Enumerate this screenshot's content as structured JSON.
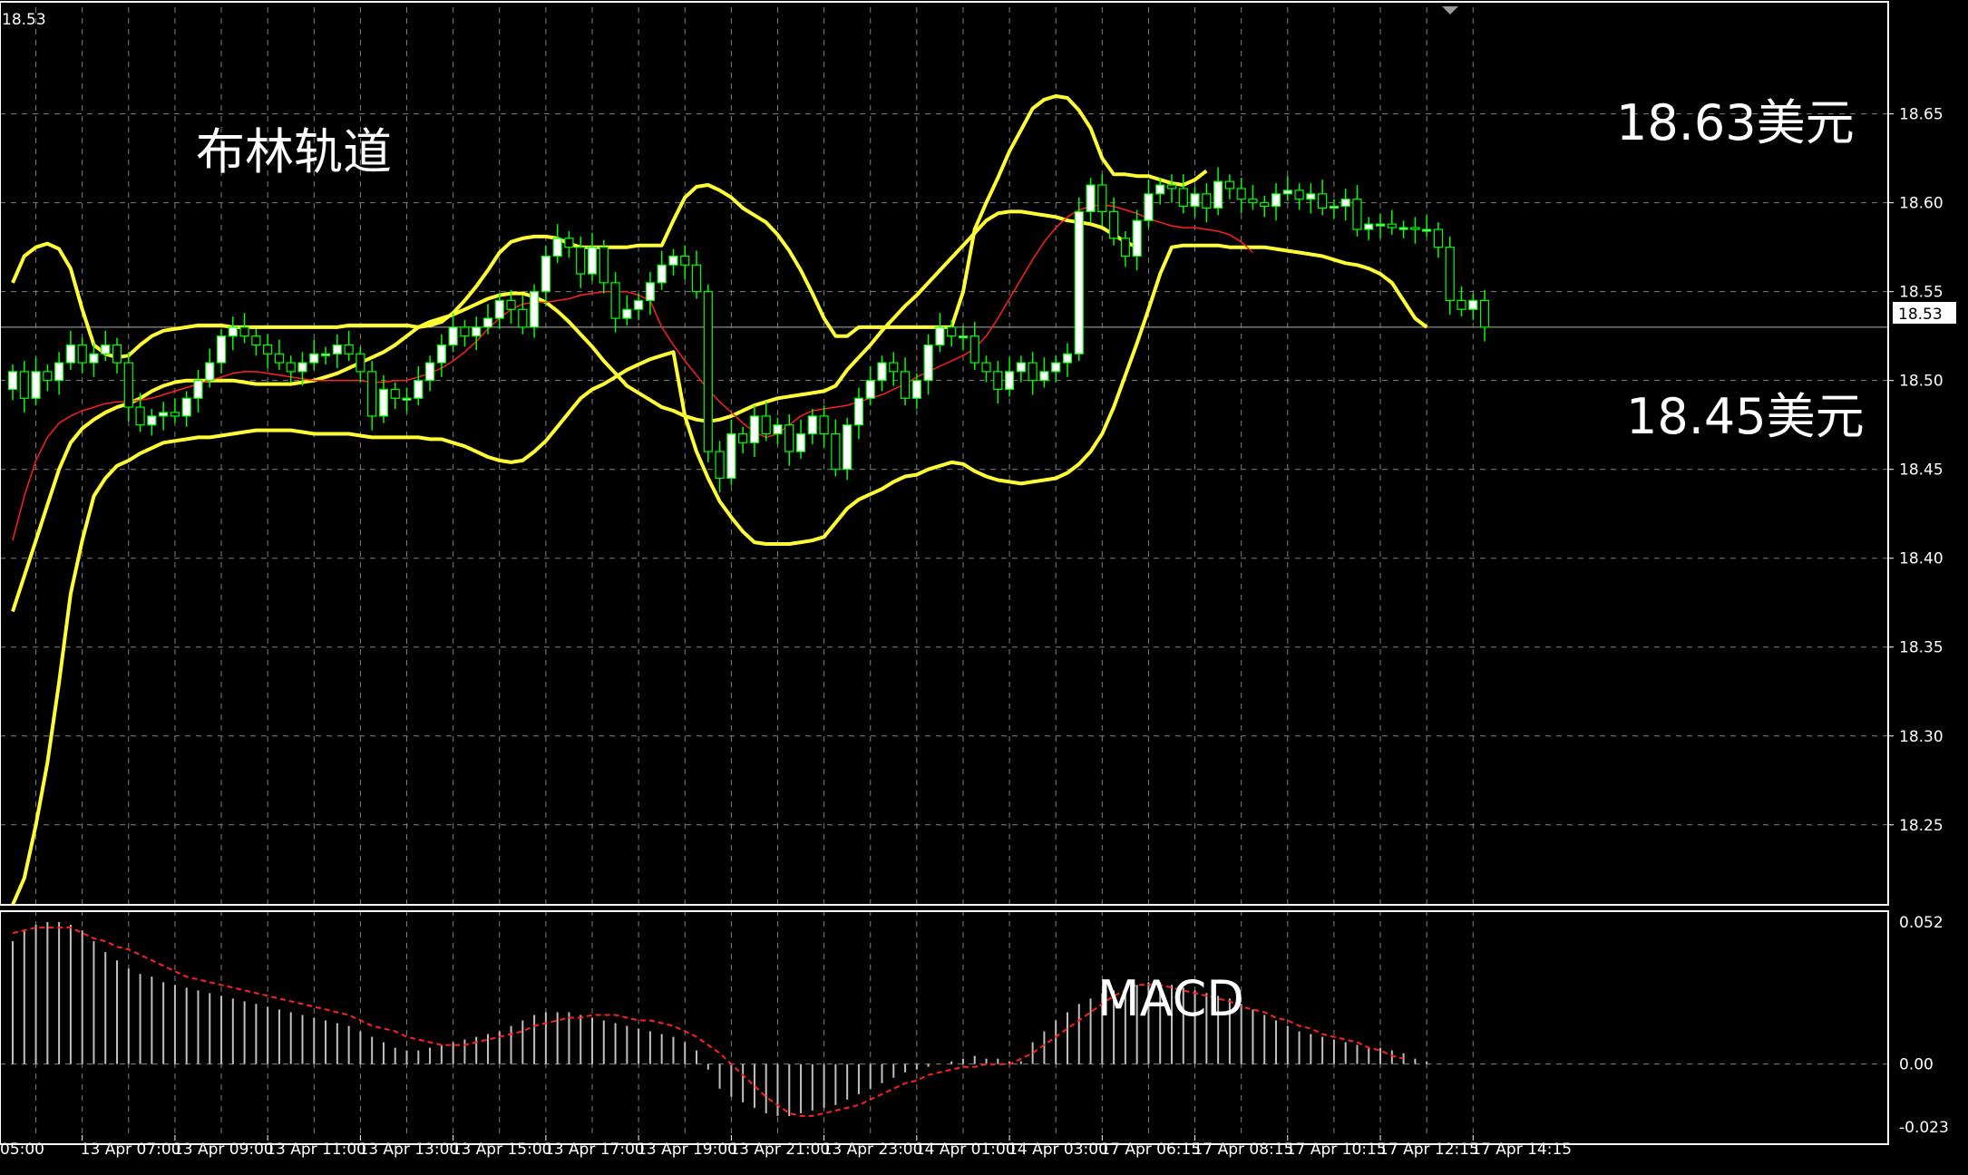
{
  "chart_data": {
    "type": "candlestick",
    "top_left_price": "18.53",
    "price_axis": {
      "ticks": [
        "18.65",
        "18.60",
        "18.55",
        "18.50",
        "18.45",
        "18.40",
        "18.35",
        "18.30",
        "18.25"
      ],
      "tick_values": [
        18.65,
        18.6,
        18.55,
        18.5,
        18.45,
        18.4,
        18.35,
        18.3,
        18.25
      ],
      "range": [
        18.205,
        18.71
      ],
      "current_price_label": "18.53",
      "current_price": 18.53
    },
    "macd_axis": {
      "ticks": [
        "0.052",
        "0.00",
        "-0.023"
      ],
      "tick_values": [
        0.052,
        0.0,
        -0.023
      ],
      "range": [
        -0.026,
        0.056
      ]
    },
    "time_axis": {
      "labels": [
        "05:00",
        "13 Apr 07:00",
        "13 Apr 09:00",
        "13 Apr 11:00",
        "13 Apr 13:00",
        "13 Apr 15:00",
        "13 Apr 17:00",
        "13 Apr 19:00",
        "13 Apr 21:00",
        "13 Apr 23:00",
        "14 Apr 01:00",
        "14 Apr 03:00",
        "17 Apr 06:15",
        "17 Apr 08:15",
        "17 Apr 10:15",
        "17 Apr 12:15",
        "17 Apr 14:15"
      ],
      "label_bar_index": [
        -2,
        6,
        14,
        22,
        30,
        38,
        46,
        54,
        62,
        70,
        78,
        86,
        94,
        102,
        110,
        118,
        126
      ]
    },
    "annotations": {
      "title": "布林轨道",
      "upper_price": "18.63美元",
      "lower_price": "18.45美元",
      "macd_label": "MACD"
    },
    "close": [
      18.505,
      18.49,
      18.505,
      18.5,
      18.51,
      18.52,
      18.51,
      18.515,
      18.52,
      18.51,
      18.485,
      18.475,
      18.48,
      18.482,
      18.48,
      18.49,
      18.5,
      18.51,
      18.525,
      18.53,
      18.525,
      18.52,
      18.515,
      18.51,
      18.505,
      18.51,
      18.515,
      18.515,
      18.52,
      18.515,
      18.505,
      18.48,
      18.495,
      18.49,
      18.49,
      18.5,
      18.51,
      18.52,
      18.53,
      18.525,
      18.53,
      18.535,
      18.545,
      18.54,
      18.53,
      18.55,
      18.57,
      18.58,
      18.575,
      18.56,
      18.575,
      18.555,
      18.535,
      18.54,
      18.545,
      18.555,
      18.565,
      18.57,
      18.565,
      18.55,
      18.46,
      18.445,
      18.47,
      18.465,
      18.48,
      18.47,
      18.475,
      18.46,
      18.47,
      18.48,
      18.47,
      18.45,
      18.475,
      18.49,
      18.5,
      18.51,
      18.505,
      18.49,
      18.5,
      18.52,
      18.53,
      18.525,
      18.525,
      18.51,
      18.505,
      18.495,
      18.505,
      18.51,
      18.5,
      18.505,
      18.51,
      18.515,
      18.595,
      18.61,
      18.595,
      18.58,
      18.57,
      18.59,
      18.605,
      18.61,
      18.608,
      18.598,
      18.605,
      18.597,
      18.612,
      18.608,
      18.602,
      18.6,
      18.598,
      18.605,
      18.607,
      18.602,
      18.605,
      18.597,
      18.598,
      18.602,
      18.585,
      18.588,
      18.588,
      18.586,
      18.586,
      18.585,
      18.585,
      18.575,
      18.545,
      18.54,
      18.545,
      18.53
    ],
    "bb_upper": [
      18.555,
      18.57,
      18.575,
      18.577,
      18.574,
      18.563,
      18.54,
      18.52,
      18.515,
      18.513,
      18.514,
      18.52,
      18.525,
      18.528,
      18.529,
      18.53,
      18.531,
      18.531,
      18.531,
      18.53,
      18.53,
      18.53,
      18.53,
      18.53,
      18.53,
      18.53,
      18.53,
      18.53,
      18.53,
      18.531,
      18.531,
      18.531,
      18.531,
      18.531,
      18.531,
      18.53,
      18.531,
      18.533,
      18.538,
      18.545,
      18.553,
      18.562,
      18.572,
      18.578,
      18.58,
      18.581,
      18.581,
      18.58,
      18.577,
      18.575,
      18.575,
      18.575,
      18.575,
      18.575,
      18.576,
      18.576,
      18.576,
      18.59,
      18.603,
      18.609,
      18.61,
      18.607,
      18.603,
      18.597,
      18.593,
      18.589,
      18.582,
      18.573,
      18.562,
      18.549,
      18.535,
      18.525,
      18.525,
      18.53,
      18.53,
      18.53,
      18.53,
      18.53,
      18.53,
      18.53,
      18.53,
      18.53,
      18.55,
      18.585,
      18.6,
      18.614,
      18.629,
      18.641,
      18.653,
      18.658,
      18.66,
      18.659,
      18.652,
      18.642,
      18.625,
      18.616,
      18.616,
      18.615,
      18.615,
      18.613,
      18.611,
      18.61,
      18.613,
      18.618
    ],
    "bb_middle": [
      18.37,
      18.39,
      18.41,
      18.43,
      18.45,
      18.465,
      18.473,
      18.478,
      18.482,
      18.485,
      18.487,
      18.49,
      18.494,
      18.497,
      18.499,
      18.5,
      18.5,
      18.5,
      18.5,
      18.5,
      18.499,
      18.498,
      18.498,
      18.498,
      18.498,
      18.499,
      18.5,
      18.502,
      18.504,
      18.507,
      18.51,
      18.513,
      18.516,
      18.52,
      18.525,
      18.53,
      18.533,
      18.535,
      18.537,
      18.54,
      18.543,
      18.546,
      18.548,
      18.549,
      18.549,
      18.547,
      18.544,
      18.539,
      18.533,
      18.526,
      18.519,
      18.511,
      18.504,
      18.497,
      18.493,
      18.489,
      18.485,
      18.483,
      18.48,
      18.478,
      18.477,
      18.478,
      18.48,
      18.483,
      18.486,
      18.488,
      18.49,
      18.491,
      18.492,
      18.493,
      18.494,
      18.497,
      18.506,
      18.513,
      18.52,
      18.528,
      18.535,
      18.542,
      18.548,
      18.555,
      18.562,
      18.569,
      18.576,
      18.583,
      18.59,
      18.594,
      18.595,
      18.595,
      18.594,
      18.593,
      18.592,
      18.59,
      18.589,
      18.588,
      18.586,
      18.582,
      18.578,
      18.575
    ],
    "bb_lower": [
      18.205,
      18.22,
      18.25,
      18.285,
      18.33,
      18.38,
      18.41,
      18.435,
      18.445,
      18.452,
      18.455,
      18.459,
      18.462,
      18.465,
      18.466,
      18.467,
      18.468,
      18.468,
      18.469,
      18.47,
      18.471,
      18.472,
      18.472,
      18.472,
      18.472,
      18.471,
      18.47,
      18.47,
      18.47,
      18.47,
      18.469,
      18.468,
      18.468,
      18.468,
      18.468,
      18.468,
      18.467,
      18.467,
      18.465,
      18.463,
      18.46,
      18.457,
      18.455,
      18.454,
      18.455,
      18.46,
      18.466,
      18.474,
      18.482,
      18.49,
      18.495,
      18.498,
      18.502,
      18.506,
      18.509,
      18.512,
      18.514,
      18.516,
      18.48,
      18.46,
      18.445,
      18.432,
      18.423,
      18.415,
      18.409,
      18.408,
      18.408,
      18.408,
      18.409,
      18.41,
      18.412,
      18.42,
      18.428,
      18.433,
      18.436,
      18.439,
      18.443,
      18.446,
      18.447,
      18.45,
      18.452,
      18.454,
      18.453,
      18.449,
      18.446,
      18.444,
      18.443,
      18.442,
      18.443,
      18.444,
      18.445,
      18.448,
      18.453,
      18.46,
      18.47,
      18.485,
      18.503,
      18.521,
      18.54,
      18.56,
      18.575,
      18.576,
      18.576,
      18.576,
      18.576,
      18.575,
      18.575,
      18.575,
      18.575,
      18.574,
      18.573,
      18.572,
      18.571,
      18.57,
      18.568,
      18.566,
      18.565,
      18.563,
      18.56,
      18.555,
      18.545,
      18.535,
      18.53
    ],
    "ma_red": [
      18.41,
      18.435,
      18.455,
      18.468,
      18.476,
      18.48,
      18.483,
      18.485,
      18.487,
      18.488,
      18.488,
      18.489,
      18.49,
      18.492,
      18.494,
      18.496,
      18.498,
      18.5,
      18.502,
      18.504,
      18.505,
      18.505,
      18.504,
      18.503,
      18.502,
      18.501,
      18.5,
      18.5,
      18.5,
      18.5,
      18.5,
      18.499,
      18.499,
      18.5,
      18.5,
      18.502,
      18.504,
      18.507,
      18.511,
      18.516,
      18.522,
      18.529,
      18.535,
      18.54,
      18.543,
      18.544,
      18.544,
      18.545,
      18.546,
      18.548,
      18.549,
      18.55,
      18.55,
      18.55,
      18.548,
      18.545,
      18.53,
      18.52,
      18.511,
      18.503,
      18.495,
      18.488,
      18.482,
      18.476,
      18.471,
      18.468,
      18.47,
      18.475,
      18.48,
      18.483,
      18.484,
      18.485,
      18.486,
      18.488,
      18.49,
      18.492,
      18.495,
      18.498,
      18.502,
      18.505,
      18.508,
      18.511,
      18.514,
      18.518,
      18.525,
      18.535,
      18.546,
      18.557,
      18.568,
      18.578,
      18.586,
      18.592,
      18.596,
      18.598,
      18.599,
      18.598,
      18.596,
      18.594,
      18.591,
      18.589,
      18.587,
      18.586,
      18.586,
      18.585,
      18.584,
      18.582,
      18.578,
      18.572
    ],
    "macd_histogram": [
      0.045,
      0.049,
      0.051,
      0.052,
      0.052,
      0.051,
      0.049,
      0.045,
      0.041,
      0.038,
      0.035,
      0.033,
      0.032,
      0.03,
      0.029,
      0.028,
      0.027,
      0.026,
      0.025,
      0.024,
      0.023,
      0.022,
      0.021,
      0.02,
      0.019,
      0.018,
      0.017,
      0.016,
      0.015,
      0.014,
      0.012,
      0.01,
      0.008,
      0.006,
      0.005,
      0.005,
      0.006,
      0.007,
      0.008,
      0.009,
      0.01,
      0.011,
      0.012,
      0.014,
      0.016,
      0.018,
      0.019,
      0.019,
      0.019,
      0.018,
      0.017,
      0.016,
      0.015,
      0.014,
      0.013,
      0.012,
      0.011,
      0.01,
      0.008,
      0.005,
      -0.002,
      -0.009,
      -0.012,
      -0.014,
      -0.016,
      -0.018,
      -0.019,
      -0.019,
      -0.018,
      -0.017,
      -0.016,
      -0.015,
      -0.013,
      -0.011,
      -0.009,
      -0.007,
      -0.005,
      -0.003,
      -0.002,
      -0.001,
      0.0,
      0.001,
      0.002,
      0.003,
      0.002,
      0.002,
      0.001,
      0.001,
      0.008,
      0.012,
      0.016,
      0.019,
      0.022,
      0.024,
      0.026,
      0.027,
      0.028,
      0.029,
      0.03,
      0.03,
      0.029,
      0.028,
      0.027,
      0.026,
      0.025,
      0.024,
      0.022,
      0.02,
      0.018,
      0.016,
      0.014,
      0.012,
      0.011,
      0.01,
      0.009,
      0.008,
      0.007,
      0.006,
      0.006,
      0.005,
      0.004,
      0.002,
      0.001
    ],
    "macd_signal": [
      0.048,
      0.049,
      0.05,
      0.05,
      0.05,
      0.05,
      0.048,
      0.046,
      0.045,
      0.043,
      0.042,
      0.04,
      0.038,
      0.036,
      0.034,
      0.032,
      0.031,
      0.03,
      0.029,
      0.028,
      0.027,
      0.026,
      0.025,
      0.024,
      0.023,
      0.022,
      0.021,
      0.02,
      0.019,
      0.018,
      0.016,
      0.014,
      0.013,
      0.012,
      0.01,
      0.009,
      0.008,
      0.007,
      0.007,
      0.007,
      0.008,
      0.009,
      0.01,
      0.011,
      0.012,
      0.014,
      0.015,
      0.016,
      0.017,
      0.017,
      0.018,
      0.018,
      0.018,
      0.017,
      0.016,
      0.016,
      0.015,
      0.014,
      0.012,
      0.01,
      0.007,
      0.004,
      0.0,
      -0.004,
      -0.008,
      -0.012,
      -0.015,
      -0.018,
      -0.019,
      -0.019,
      -0.018,
      -0.017,
      -0.016,
      -0.015,
      -0.013,
      -0.011,
      -0.009,
      -0.007,
      -0.006,
      -0.004,
      -0.003,
      -0.002,
      -0.001,
      -0.001,
      0.0,
      0.0,
      0.0,
      0.002,
      0.004,
      0.007,
      0.01,
      0.013,
      0.016,
      0.019,
      0.022,
      0.025,
      0.027,
      0.029,
      0.029,
      0.029,
      0.028,
      0.027,
      0.026,
      0.025,
      0.024,
      0.023,
      0.021,
      0.02,
      0.019,
      0.017,
      0.016,
      0.014,
      0.013,
      0.011,
      0.01,
      0.009,
      0.008,
      0.006,
      0.005,
      0.003,
      0.002
    ],
    "colors": {
      "background": "#000000",
      "grid": "#7f7f7f",
      "bull_candle": "#ffffff",
      "bear_candle": "#000000",
      "wick": "#00ff00",
      "bollinger": "#ffff33",
      "moving_average": "#ff2020",
      "macd_histogram": "#c0c0c0",
      "macd_signal": "#ff2020",
      "axis_text": "#ffffff",
      "border": "#ffffff"
    }
  }
}
